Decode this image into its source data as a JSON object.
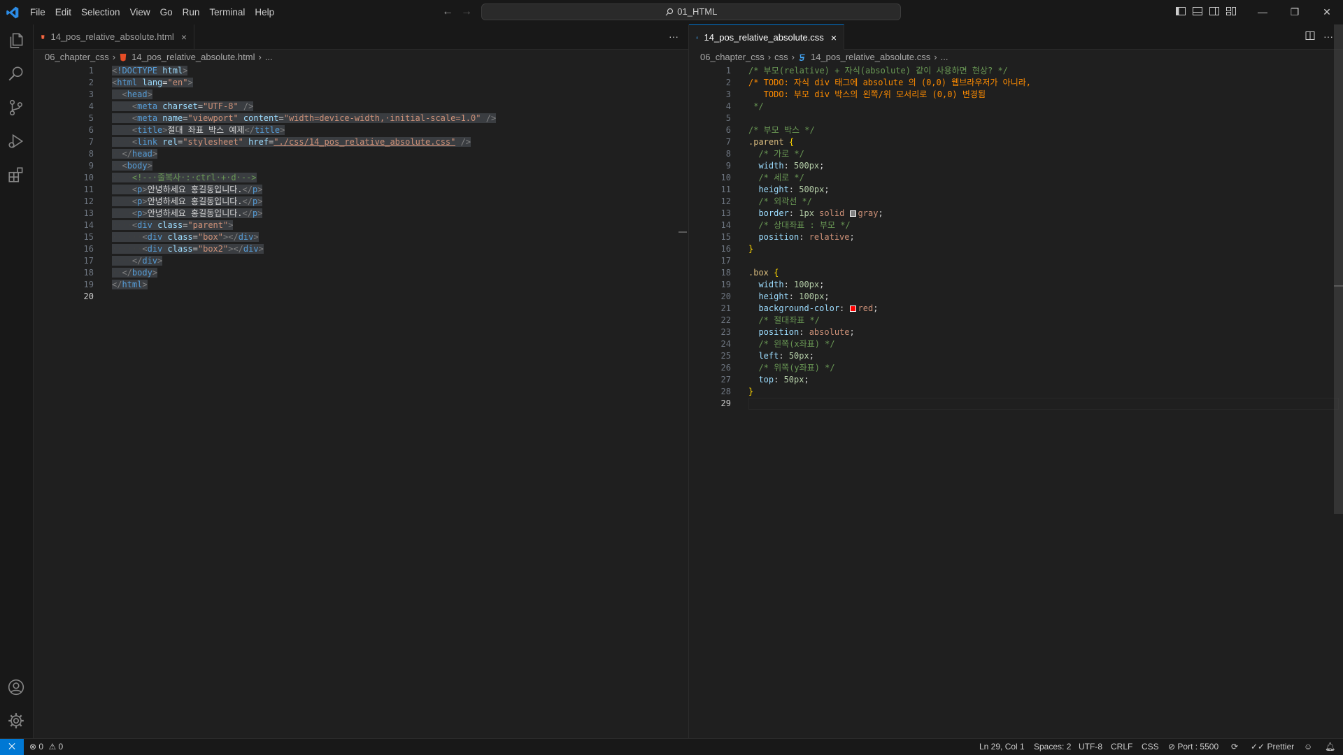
{
  "menu": [
    "File",
    "Edit",
    "Selection",
    "View",
    "Go",
    "Run",
    "Terminal",
    "Help"
  ],
  "search": {
    "label": "01_HTML"
  },
  "left": {
    "tab_label": "14_pos_relative_absolute.html",
    "breadcrumb": [
      "06_chapter_css",
      "14_pos_relative_absolute.html",
      "..."
    ],
    "lines": [
      {
        "n": "1",
        "t": "<!DOCTYPE html>"
      },
      {
        "n": "2",
        "t": "<html lang=\"en\">"
      },
      {
        "n": "3",
        "t": "  <head>"
      },
      {
        "n": "4",
        "t": "    <meta charset=\"UTF-8\" />"
      },
      {
        "n": "5",
        "t": "    <meta name=\"viewport\" content=\"width=device-width, initial-scale=1.0\" />"
      },
      {
        "n": "6",
        "t": "    <title>절대 좌표 박스 예제</title>"
      },
      {
        "n": "7",
        "t": "    <link rel=\"stylesheet\" href=\"./css/14_pos_relative_absolute.css\" />"
      },
      {
        "n": "8",
        "t": "  </head>"
      },
      {
        "n": "9",
        "t": "  <body>"
      },
      {
        "n": "10",
        "t": "    <!-- 줄복사 : ctrl + d -->"
      },
      {
        "n": "11",
        "t": "    <p>안녕하세요 홍길동입니다.</p>"
      },
      {
        "n": "12",
        "t": "    <p>안녕하세요 홍길동입니다.</p>"
      },
      {
        "n": "13",
        "t": "    <p>안녕하세요 홍길동입니다.</p>"
      },
      {
        "n": "14",
        "t": "    <div class=\"parent\">"
      },
      {
        "n": "15",
        "t": "      <div class=\"box\"></div>"
      },
      {
        "n": "16",
        "t": "      <div class=\"box2\"></div>"
      },
      {
        "n": "17",
        "t": "    </div>"
      },
      {
        "n": "18",
        "t": "  </body>"
      },
      {
        "n": "19",
        "t": "</html>"
      },
      {
        "n": "20",
        "t": ""
      }
    ]
  },
  "right": {
    "tab_label": "14_pos_relative_absolute.css",
    "breadcrumb": [
      "06_chapter_css",
      "css",
      "14_pos_relative_absolute.css",
      "..."
    ],
    "lines": [
      {
        "n": "1",
        "t": "/* 부모(relative) + 자식(absolute) 같이 사용하면 현상? */"
      },
      {
        "n": "2",
        "t": "/* TODO: 자식 div 태그에 absolute 의 (0,0) 웹브라우저가 아니라,"
      },
      {
        "n": "3",
        "t": "   TODO: 부모 div 박스의 왼쪽/위 모서리로 (0,0) 변경됨"
      },
      {
        "n": "4",
        "t": " */"
      },
      {
        "n": "5",
        "t": ""
      },
      {
        "n": "6",
        "t": "/* 부모 박스 */"
      },
      {
        "n": "7",
        "t": ".parent {"
      },
      {
        "n": "8",
        "t": "  /* 가로 */"
      },
      {
        "n": "9",
        "t": "  width: 500px;"
      },
      {
        "n": "10",
        "t": "  /* 세로 */"
      },
      {
        "n": "11",
        "t": "  height: 500px;"
      },
      {
        "n": "12",
        "t": "  /* 외곽선 */"
      },
      {
        "n": "13",
        "t": "  border: 1px solid gray;"
      },
      {
        "n": "14",
        "t": "  /* 상대좌표 : 부모 */"
      },
      {
        "n": "15",
        "t": "  position: relative;"
      },
      {
        "n": "16",
        "t": "}"
      },
      {
        "n": "17",
        "t": ""
      },
      {
        "n": "18",
        "t": ".box {"
      },
      {
        "n": "19",
        "t": "  width: 100px;"
      },
      {
        "n": "20",
        "t": "  height: 100px;"
      },
      {
        "n": "21",
        "t": "  background-color: red;"
      },
      {
        "n": "22",
        "t": "  /* 절대좌표 */"
      },
      {
        "n": "23",
        "t": "  position: absolute;"
      },
      {
        "n": "24",
        "t": "  /* 왼쪽(x좌표) */"
      },
      {
        "n": "25",
        "t": "  left: 50px;"
      },
      {
        "n": "26",
        "t": "  /* 위쪽(y좌표) */"
      },
      {
        "n": "27",
        "t": "  top: 50px;"
      },
      {
        "n": "28",
        "t": "}"
      },
      {
        "n": "29",
        "t": ""
      }
    ]
  },
  "status": {
    "errors": "0",
    "warnings": "0",
    "position": "Ln 29, Col 1",
    "spaces": "Spaces: 2",
    "encoding": "UTF-8",
    "eol": "CRLF",
    "language": "CSS",
    "port": "Port : 5500",
    "prettier": "Prettier"
  },
  "colors": {
    "accent": "#0078d4",
    "html_icon": "#e44d26",
    "css_icon": "#42a5f5",
    "swatch_gray": "#808080",
    "swatch_red": "#ff0000"
  }
}
